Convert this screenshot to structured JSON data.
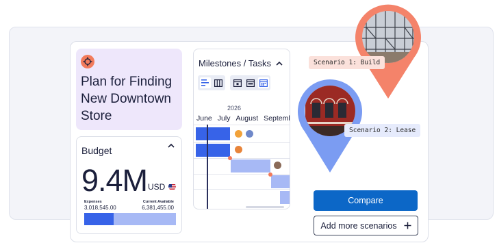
{
  "plan": {
    "title": "Plan for Finding New Downtown Store",
    "icon": "target-icon"
  },
  "budget": {
    "title": "Budget",
    "value": "9.4M",
    "unit": "USD",
    "expenses_label": "Expenses",
    "expenses_value": "3,018,545.00",
    "available_label": "Current Available",
    "available_value": "6,381,455.00",
    "spent_fraction": 0.32
  },
  "milestones": {
    "title": "Milestones / Tasks",
    "year": "2026",
    "months": [
      "June",
      "July",
      "August",
      "Septemb"
    ]
  },
  "scenarios": {
    "build_label": "Scenario 1: Build",
    "lease_label": "Scenario 2: Lease"
  },
  "actions": {
    "compare_label": "Compare",
    "add_label": "Add more scenarios",
    "add_icon": "plus-icon"
  },
  "colors": {
    "accent": "#0c67c7",
    "build": "#f27b5c",
    "lease": "#7b9cf2",
    "plan_bg": "#eee7fb"
  }
}
